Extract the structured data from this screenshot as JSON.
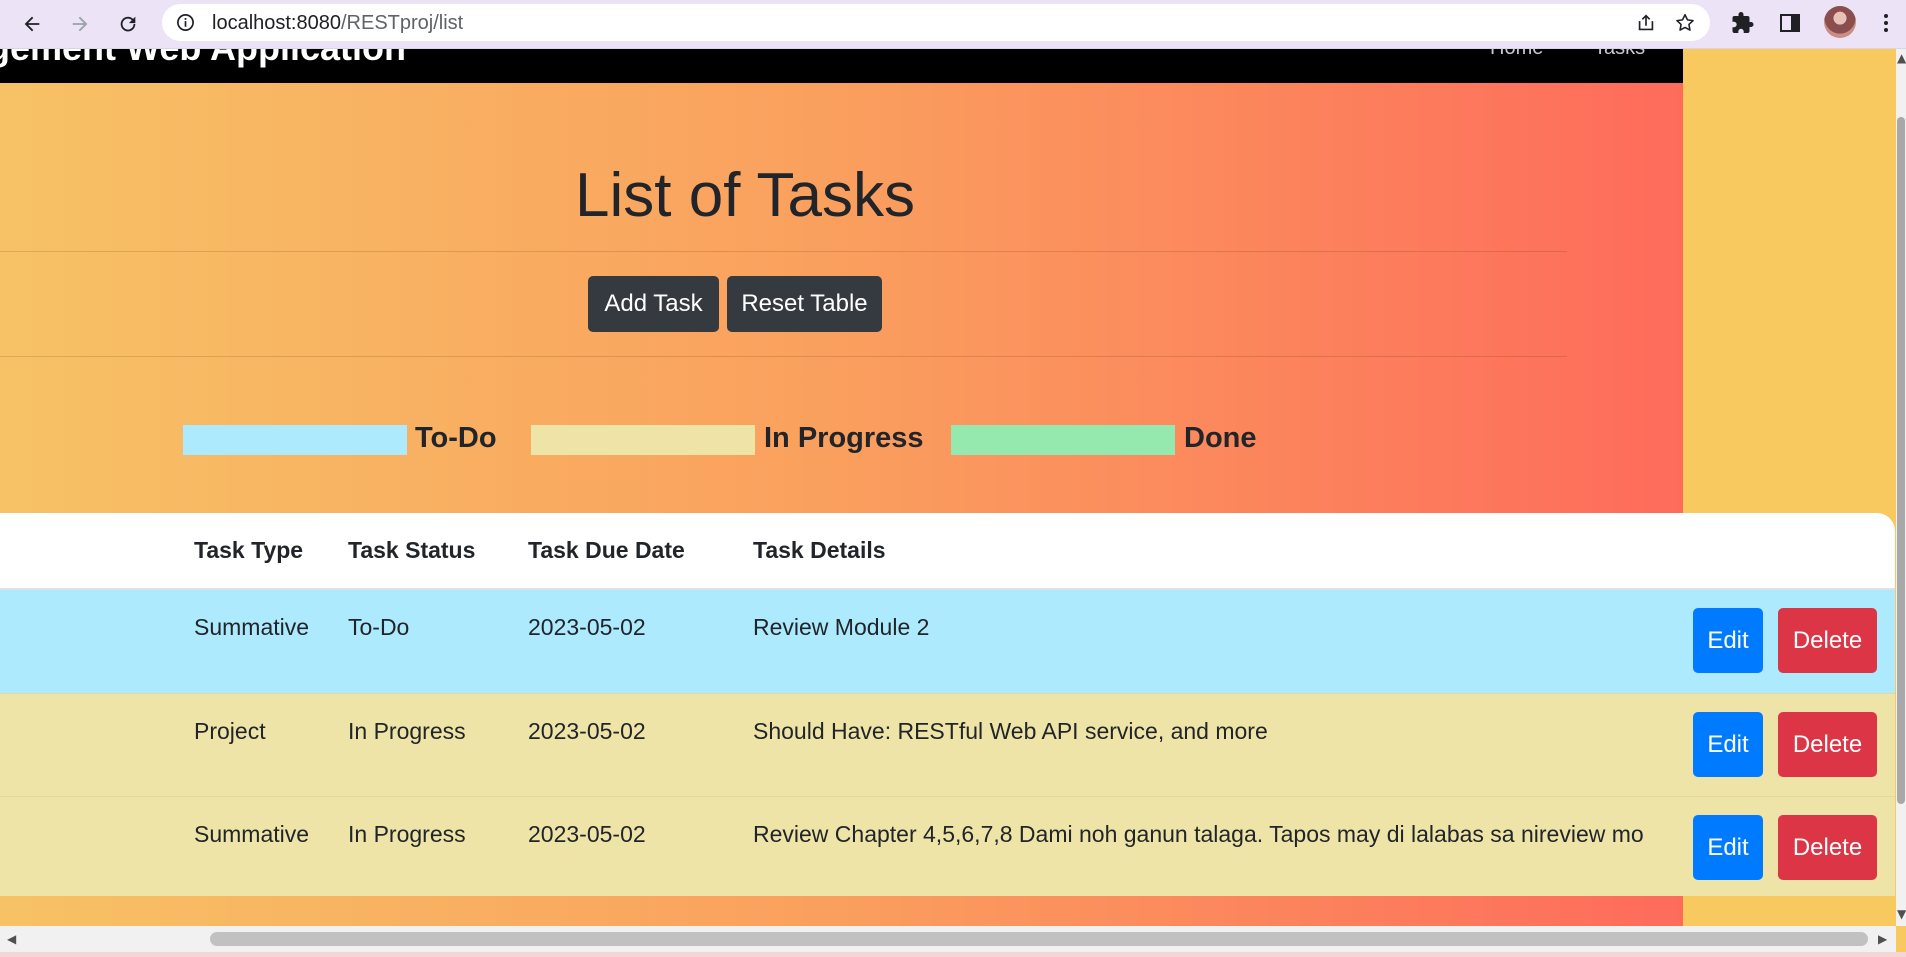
{
  "browser": {
    "url_host": "localhost:8080",
    "url_path": "/RESTproj/list",
    "icons": [
      "back-icon",
      "forward-icon",
      "reload-icon",
      "site-info-icon",
      "share-icon",
      "bookmark-star-icon",
      "extensions-icon",
      "side-panel-icon",
      "profile-avatar",
      "menu-icon"
    ]
  },
  "header": {
    "brand": "gement Web Application",
    "nav": [
      "Home",
      "Tasks"
    ]
  },
  "main": {
    "title": "List of Tasks",
    "add_task_label": "Add Task",
    "reset_table_label": "Reset Table"
  },
  "legend": {
    "items": [
      {
        "label": "To-Do",
        "color": "#aeeafd"
      },
      {
        "label": "In Progress",
        "color": "#efe4a7"
      },
      {
        "label": "Done",
        "color": "#95e9ae"
      }
    ]
  },
  "table": {
    "headers": [
      "Task Type",
      "Task Status",
      "Task Due Date",
      "Task Details"
    ],
    "edit_label": "Edit",
    "delete_label": "Delete",
    "rows": [
      {
        "type": "Summative",
        "status": "To-Do",
        "due": "2023-05-02",
        "details": "Review Module 2",
        "color": "#aeeafd"
      },
      {
        "type": "Project",
        "status": "In Progress",
        "due": "2023-05-02",
        "details": "Should Have: RESTful Web API service, and more",
        "color": "#efe4a7"
      },
      {
        "type": "Summative",
        "status": "In Progress",
        "due": "2023-05-02",
        "details": "Review Chapter 4,5,6,7,8 Dami noh ganun talaga. Tapos may di lalabas sa nireview mo",
        "color": "#efe4a7"
      }
    ]
  },
  "colors": {
    "gradient_start": "#f7c265",
    "gradient_end": "#fe6b5b",
    "edit_blue": "#007bff",
    "delete_red": "#dc3545",
    "dark_button": "#343a40"
  }
}
